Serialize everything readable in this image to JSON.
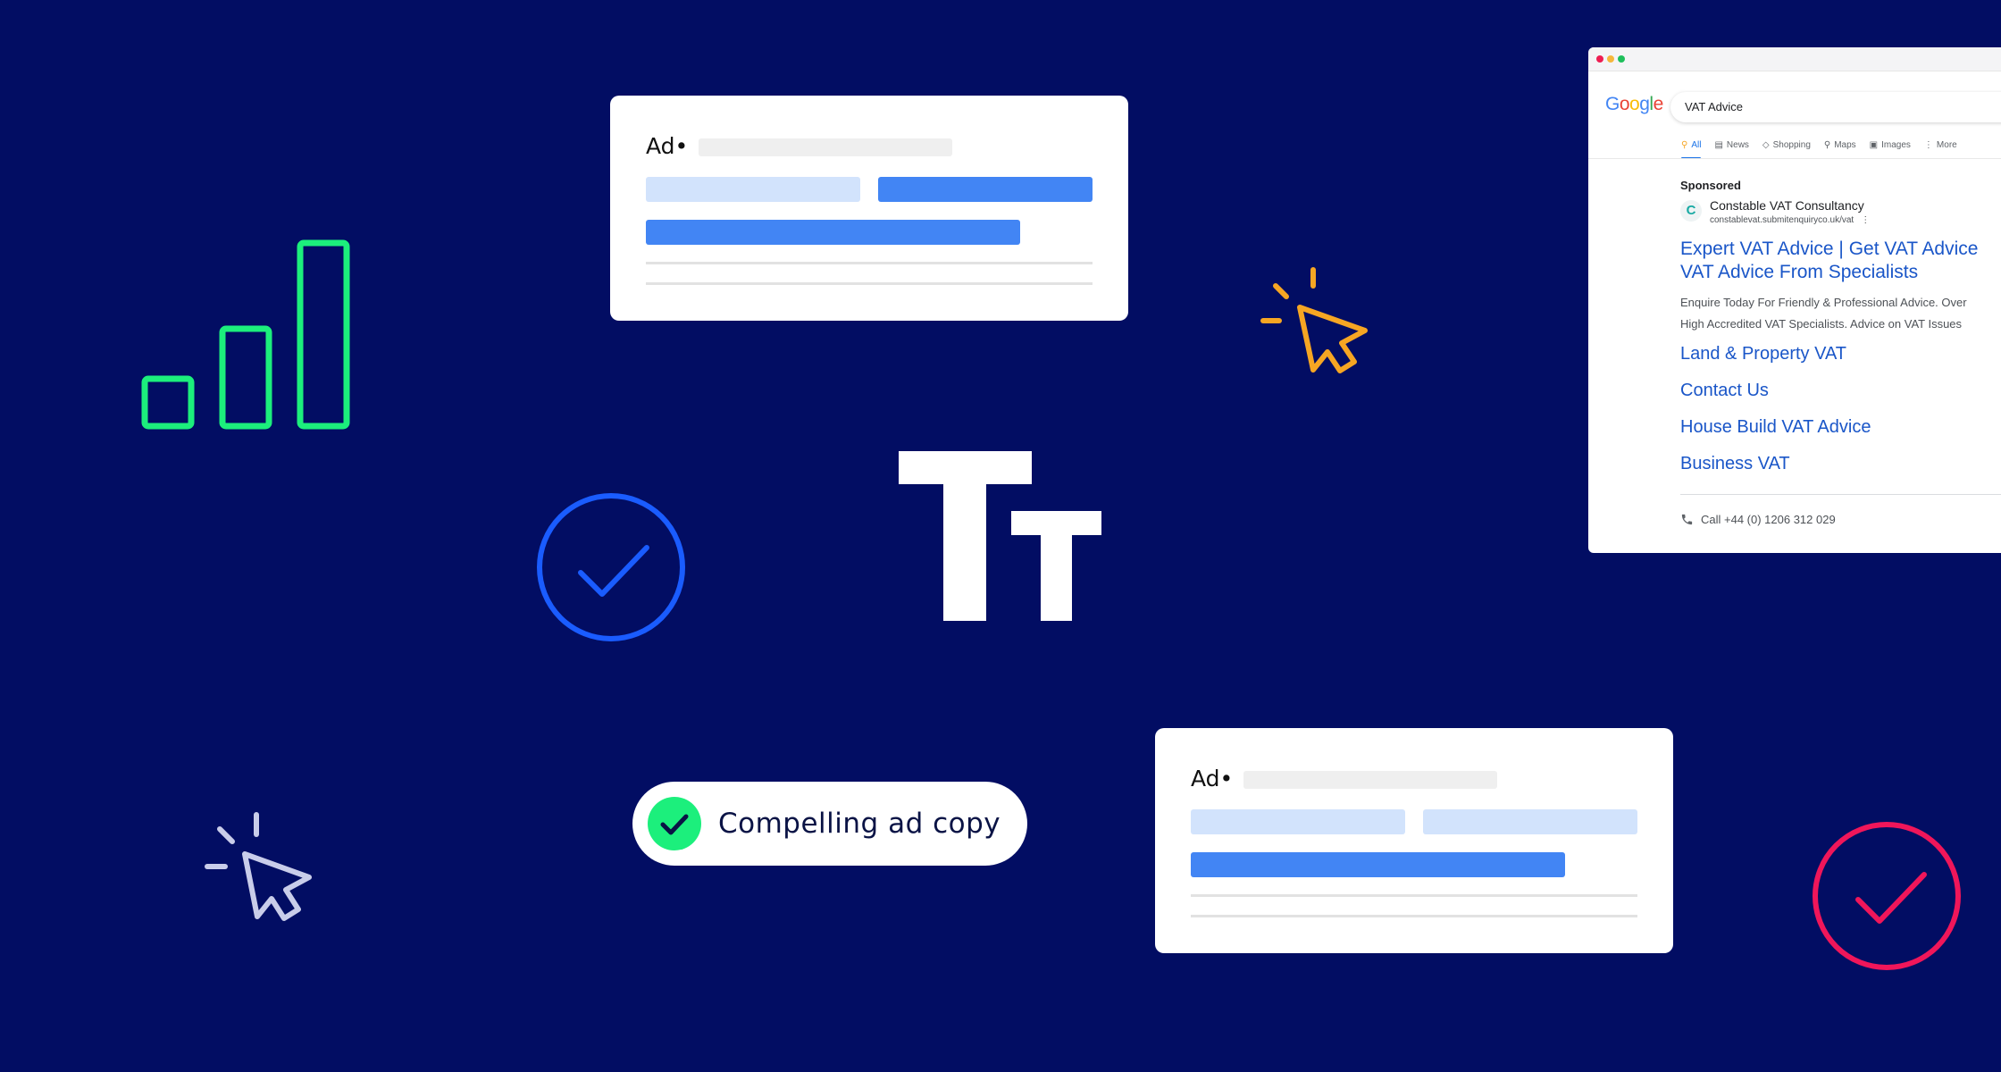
{
  "colors": {
    "background": "#020d63",
    "bars_icon": "#1cef7c",
    "cursor_orange": "#f6a623",
    "cursor_light": "#c9cdea",
    "check_blue": "#1a5cff",
    "check_pink": "#f0165a",
    "pill_check": "#1cef7c",
    "link_blue": "#1a56c8",
    "ad_blue": "#4285f4",
    "ad_light_blue": "#d2e3fc"
  },
  "icons": {
    "bar_chart": "bar-chart-icon",
    "cursor_click_orange": "cursor-click-icon",
    "cursor_click_light": "cursor-click-icon",
    "check_circle_blue": "check-circle-icon",
    "check_circle_pink": "check-circle-icon",
    "text_size": "text-size-icon"
  },
  "ad_card_top": {
    "label": "Ad•"
  },
  "ad_card_bottom": {
    "label": "Ad•"
  },
  "pill": {
    "label": "Compelling ad copy"
  },
  "browser": {
    "logo": [
      "G",
      "o",
      "o",
      "g",
      "l",
      "e"
    ],
    "search_query": "VAT Advice",
    "tabs": [
      {
        "label": "All",
        "icon": "search-icon",
        "active": true
      },
      {
        "label": "News",
        "icon": "news-icon",
        "active": false
      },
      {
        "label": "Shopping",
        "icon": "tag-icon",
        "active": false
      },
      {
        "label": "Maps",
        "icon": "map-pin-icon",
        "active": false
      },
      {
        "label": "Images",
        "icon": "image-icon",
        "active": false
      },
      {
        "label": "More",
        "icon": "more-vertical-icon",
        "active": false
      }
    ],
    "sponsored": "Sponsored",
    "favicon_letter": "C",
    "advertiser": "Constable VAT Consultancy",
    "url": "constablevat.submitenquiryco.uk/vat",
    "headline_1": "Expert VAT Advice | Get VAT Advice",
    "headline_2": "VAT Advice From Specialists",
    "description_1": "Enquire Today For Friendly & Professional Advice. Over",
    "description_2": "High Accredited VAT Specialists. Advice on VAT Issues",
    "sitelinks": [
      "Land & Property VAT",
      "Contact Us",
      "House Build VAT Advice",
      "Business VAT"
    ],
    "call": "Call +44 (0) 1206 312 029"
  }
}
